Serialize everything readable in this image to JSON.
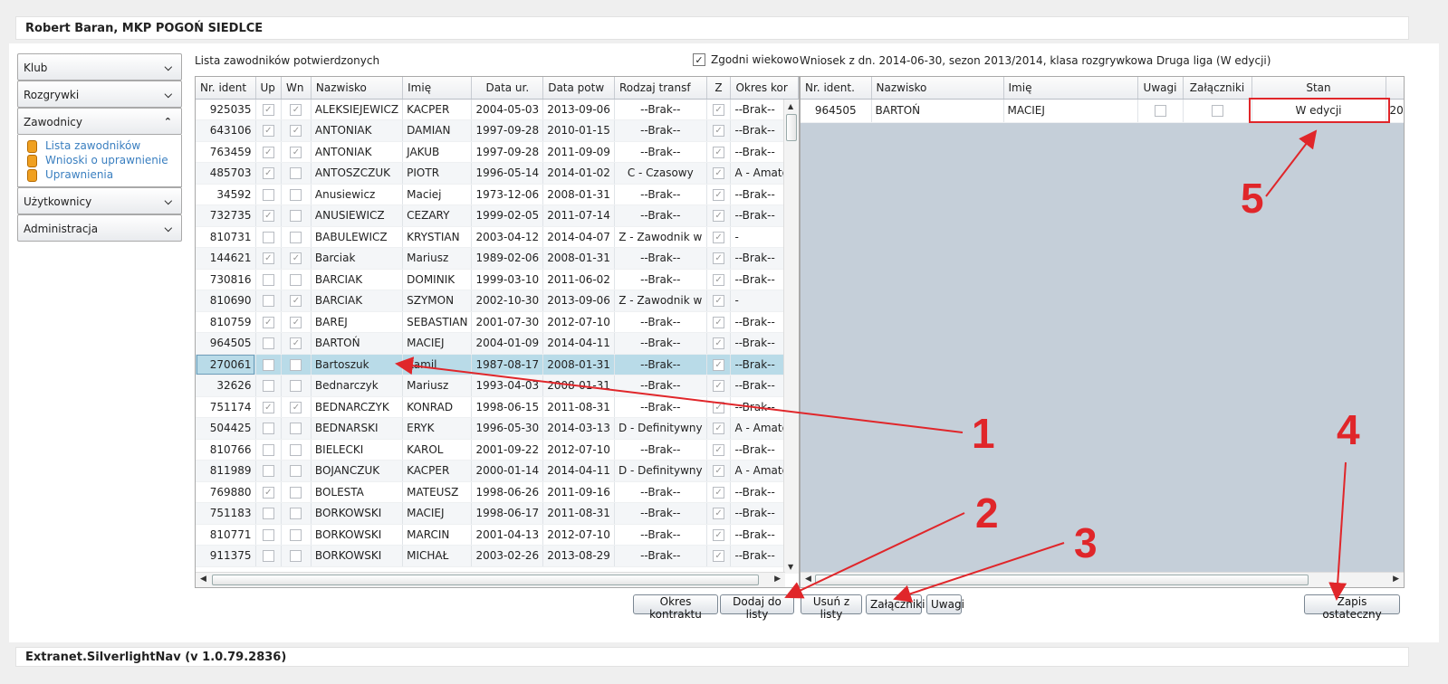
{
  "header": {
    "title": "Robert Baran, MKP POGOŃ SIEDLCE"
  },
  "footer": {
    "version": "Extranet.SilverlightNav (v 1.0.79.2836)"
  },
  "sidebar": {
    "sections": [
      {
        "label": "Klub"
      },
      {
        "label": "Rozgrywki"
      },
      {
        "label": "Zawodnicy"
      },
      {
        "label": "Użytkownicy"
      },
      {
        "label": "Administracja"
      }
    ],
    "zawodnicy_links": [
      "Lista zawodników",
      "Wnioski o uprawnienie",
      "Uprawnienia"
    ]
  },
  "left_panel": {
    "title": "Lista zawodników potwierdzonych",
    "age_filter_label": "Zgodni wiekowo",
    "age_filter_checked": true,
    "columns": [
      "Nr. ident",
      "Up",
      "Wn",
      "Nazwisko",
      "Imię",
      "Data ur.",
      "Data potw",
      "Rodzaj transf",
      "Z",
      "Okres kor"
    ],
    "rows": [
      [
        "925035",
        true,
        true,
        "ALEKSIEJEWICZ",
        "KACPER",
        "2004-05-03",
        "2013-09-06",
        "--Brak--",
        true,
        "--Brak--"
      ],
      [
        "643106",
        true,
        true,
        "ANTONIAK",
        "DAMIAN",
        "1997-09-28",
        "2010-01-15",
        "--Brak--",
        true,
        "--Brak--"
      ],
      [
        "763459",
        true,
        true,
        "ANTONIAK",
        "JAKUB",
        "1997-09-28",
        "2011-09-09",
        "--Brak--",
        true,
        "--Brak--"
      ],
      [
        "485703",
        true,
        false,
        "ANTOSZCZUK",
        "PIOTR",
        "1996-05-14",
        "2014-01-02",
        "C - Czasowy",
        true,
        "A - Amator"
      ],
      [
        "34592",
        false,
        false,
        "Anusiewicz",
        "Maciej",
        "1973-12-06",
        "2008-01-31",
        "--Brak--",
        true,
        "--Brak--"
      ],
      [
        "732735",
        true,
        false,
        "ANUSIEWICZ",
        "CEZARY",
        "1999-02-05",
        "2011-07-14",
        "--Brak--",
        true,
        "--Brak--"
      ],
      [
        "810731",
        false,
        false,
        "BABULEWICZ",
        "KRYSTIAN",
        "2003-04-12",
        "2014-04-07",
        "Z - Zawodnik w",
        true,
        "-"
      ],
      [
        "144621",
        true,
        true,
        "Barciak",
        "Mariusz",
        "1989-02-06",
        "2008-01-31",
        "--Brak--",
        true,
        "--Brak--"
      ],
      [
        "730816",
        false,
        false,
        "BARCIAK",
        "DOMINIK",
        "1999-03-10",
        "2011-06-02",
        "--Brak--",
        true,
        "--Brak--"
      ],
      [
        "810690",
        false,
        true,
        "BARCIAK",
        "SZYMON",
        "2002-10-30",
        "2013-09-06",
        "Z - Zawodnik w",
        true,
        "-"
      ],
      [
        "810759",
        true,
        true,
        "BAREJ",
        "SEBASTIAN",
        "2001-07-30",
        "2012-07-10",
        "--Brak--",
        true,
        "--Brak--"
      ],
      [
        "964505",
        false,
        true,
        "BARTOŃ",
        "MACIEJ",
        "2004-01-09",
        "2014-04-11",
        "--Brak--",
        true,
        "--Brak--"
      ],
      [
        "270061",
        false,
        false,
        "Bartoszuk",
        "Kamil",
        "1987-08-17",
        "2008-01-31",
        "--Brak--",
        true,
        "--Brak--"
      ],
      [
        "32626",
        false,
        false,
        "Bednarczyk",
        "Mariusz",
        "1993-04-03",
        "2008-01-31",
        "--Brak--",
        true,
        "--Brak--"
      ],
      [
        "751174",
        true,
        true,
        "BEDNARCZYK",
        "KONRAD",
        "1998-06-15",
        "2011-08-31",
        "--Brak--",
        true,
        "--Brak--"
      ],
      [
        "504425",
        false,
        false,
        "BEDNARSKI",
        "ERYK",
        "1996-05-30",
        "2014-03-13",
        "D - Definitywny",
        true,
        "A - Amator"
      ],
      [
        "810766",
        false,
        false,
        "BIELECKI",
        "KAROL",
        "2001-09-22",
        "2012-07-10",
        "--Brak--",
        true,
        "--Brak--"
      ],
      [
        "811989",
        false,
        false,
        "BOJANCZUK",
        "KACPER",
        "2000-01-14",
        "2014-04-11",
        "D - Definitywny",
        true,
        "A - Amator"
      ],
      [
        "769880",
        true,
        false,
        "BOLESTA",
        "MATEUSZ",
        "1998-06-26",
        "2011-09-16",
        "--Brak--",
        true,
        "--Brak--"
      ],
      [
        "751183",
        false,
        false,
        "BORKOWSKI",
        "MACIEJ",
        "1998-06-17",
        "2011-08-31",
        "--Brak--",
        true,
        "--Brak--"
      ],
      [
        "810771",
        false,
        false,
        "BORKOWSKI",
        "MARCIN",
        "2001-04-13",
        "2012-07-10",
        "--Brak--",
        true,
        "--Brak--"
      ],
      [
        "911375",
        false,
        false,
        "BORKOWSKI",
        "MICHAŁ",
        "2003-02-26",
        "2013-08-29",
        "--Brak--",
        true,
        "--Brak--"
      ]
    ],
    "selected_row": 12
  },
  "right_panel": {
    "title": "Wniosek z dn. 2014-06-30, sezon 2013/2014, klasa rozgrywkowa Druga liga (W edycji)",
    "columns": [
      "Nr. ident.",
      "Nazwisko",
      "Imię",
      "Uwagi",
      "Załączniki",
      "Stan"
    ],
    "rows": [
      {
        "id": "964505",
        "surname": "BARTOŃ",
        "name": "MACIEJ",
        "uwagi": false,
        "zalaczniki": false,
        "stan": "W edycji",
        "extra": "20"
      }
    ]
  },
  "buttons": {
    "okres": "Okres kontraktu",
    "dodaj": "Dodaj do listy",
    "usun": "Usuń z listy",
    "zalaczniki": "Załączniki",
    "uwagi": "Uwagi",
    "zapis": "Zapis ostateczny"
  },
  "annotations": [
    "1",
    "2",
    "3",
    "4",
    "5"
  ],
  "colors": {
    "annotation": "#e0262a",
    "selected_row": "#b9dbe8",
    "link": "#3a7fc0"
  }
}
